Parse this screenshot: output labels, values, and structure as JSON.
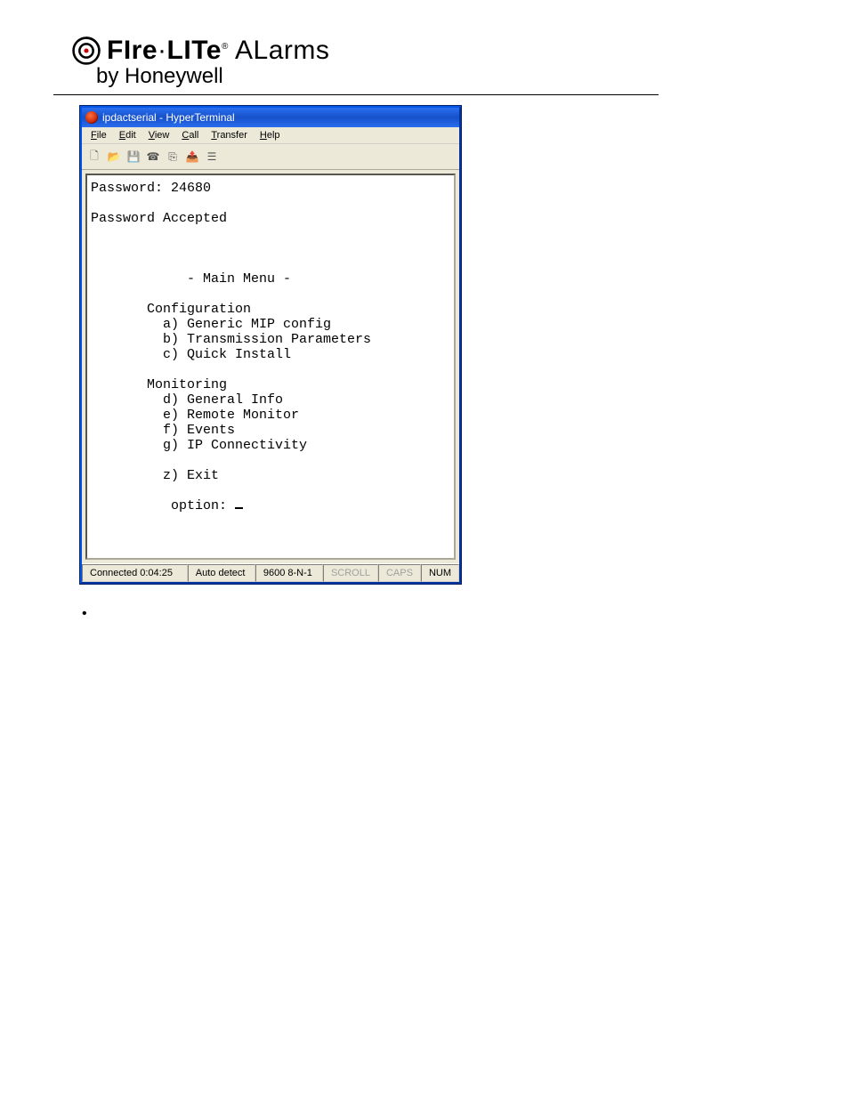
{
  "brand": {
    "main_before_dot": "FIre",
    "main_after_dot": "LITe",
    "registered": "®",
    "main_rest": " ALarms",
    "sub": "by Honeywell"
  },
  "window": {
    "title": "ipdactserial - HyperTerminal",
    "menu": [
      "File",
      "Edit",
      "View",
      "Call",
      "Transfer",
      "Help"
    ]
  },
  "terminal": {
    "password_line": "Password: 24680",
    "accepted_line": "Password Accepted",
    "menu_title": "- Main Menu -",
    "section1": "Configuration",
    "s1a": "a) Generic MIP config",
    "s1b": "b) Transmission Parameters",
    "s1c": "c) Quick Install",
    "section2": "Monitoring",
    "s2d": "d) General Info",
    "s2e": "e) Remote Monitor",
    "s2f": "f) Events",
    "s2g": "g) IP Connectivity",
    "exit": "z) Exit",
    "option": " option: "
  },
  "status": {
    "connected": "Connected 0:04:25",
    "detect": "Auto detect",
    "serial": "9600 8-N-1",
    "scroll": "SCROLL",
    "caps": "CAPS",
    "num": "NUM"
  },
  "bullet": "•"
}
